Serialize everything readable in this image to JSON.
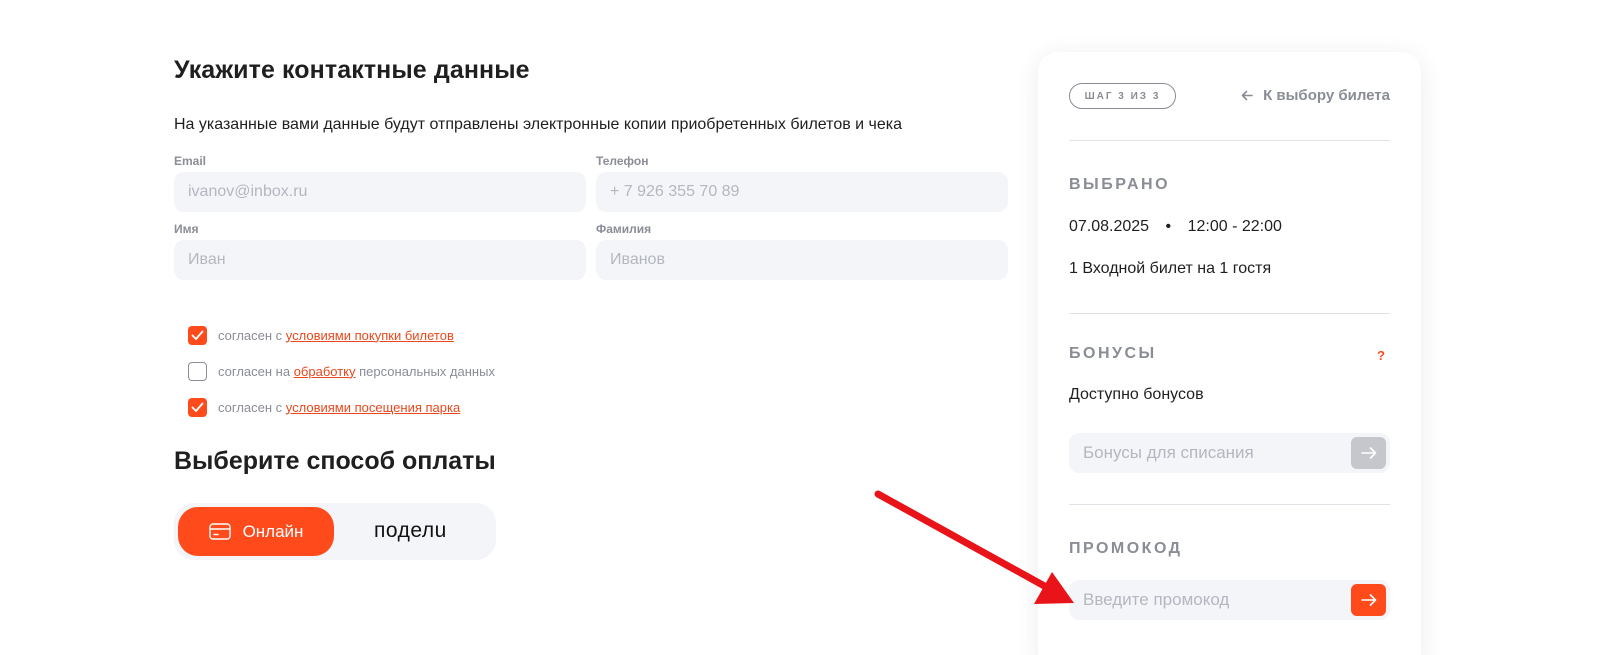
{
  "form": {
    "title": "Укажите контактные данные",
    "subtitle": "На указанные вами данные будут отправлены электронные копии приобретенных билетов и чека",
    "email": {
      "label": "Email",
      "placeholder": "ivanov@inbox.ru"
    },
    "phone": {
      "label": "Телефон",
      "placeholder": "+ 7 926 355 70 89"
    },
    "first_name": {
      "label": "Имя",
      "placeholder": "Иван"
    },
    "last_name": {
      "label": "Фамилия",
      "placeholder": "Иванов"
    }
  },
  "consents": [
    {
      "checked": true,
      "prefix": "согласен с ",
      "link": "условиями покупки билетов",
      "suffix": ""
    },
    {
      "checked": false,
      "prefix": "согласен на ",
      "link": "обработку",
      "suffix": " персональных данных"
    },
    {
      "checked": true,
      "prefix": "согласен с ",
      "link": "условиями посещения парка",
      "suffix": ""
    }
  ],
  "payment": {
    "title": "Выберите способ оплаты",
    "online_label": "Онлайн",
    "podeli_label": "поделu"
  },
  "summary": {
    "step_badge": "ШАГ 3 ИЗ 3",
    "back_label": "К выбору билета",
    "selected_title": "ВЫБРАНО",
    "date": "07.08.2025",
    "separator": "•",
    "time": "12:00 - 22:00",
    "ticket": "1 Входной билет на 1 гостя",
    "bonus_title": "БОНУСЫ",
    "bonus_help": "?",
    "bonus_available": "Доступно бонусов",
    "bonus_placeholder": "Бонусы для списания",
    "promo_title": "ПРОМОКОД",
    "promo_placeholder": "Введите промокод"
  },
  "colors": {
    "accent": "#ff4a1c",
    "muted": "#8a8d96",
    "input_bg": "#f4f5f9",
    "annotation_arrow": "#e8141a"
  }
}
